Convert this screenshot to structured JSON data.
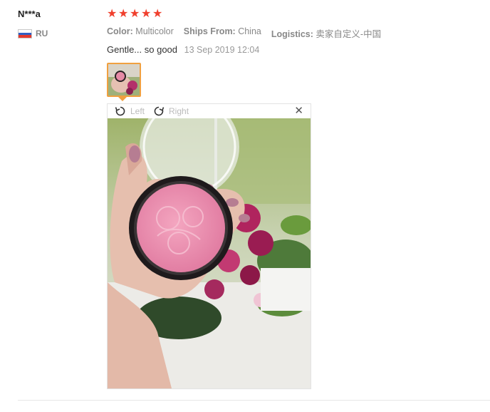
{
  "review": {
    "user_name": "N***a",
    "country": "RU",
    "rating": 5,
    "color_label": "Color:",
    "color_value": "Multicolor",
    "ships_label": "Ships From:",
    "ships_value": "China",
    "logistics_label": "Logistics:",
    "logistics_value": "卖家自定义-中国",
    "text": "Gentle... so good",
    "date": "13 Sep 2019 12:04"
  },
  "viewer": {
    "rotate_left_label": "Left",
    "rotate_right_label": "Right",
    "close_symbol": "✕"
  },
  "colors": {
    "star": "#f0402e",
    "thumb_border": "#f0a040"
  }
}
